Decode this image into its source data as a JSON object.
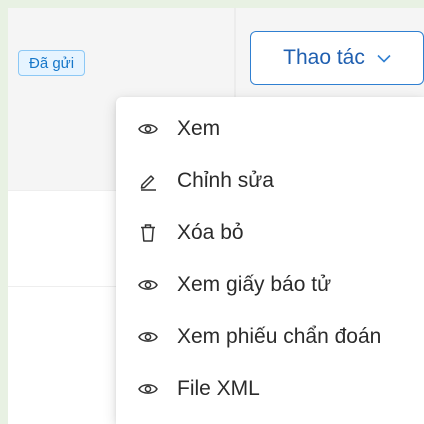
{
  "row": {
    "status_badge": "Đã gửi"
  },
  "actions": {
    "button_label": "Thao tác",
    "menu": [
      {
        "label": "Xem",
        "icon": "eye-icon"
      },
      {
        "label": "Chỉnh sửa",
        "icon": "pencil-icon"
      },
      {
        "label": "Xóa bỏ",
        "icon": "trash-icon"
      },
      {
        "label": "Xem giấy báo tử",
        "icon": "eye-icon"
      },
      {
        "label": "Xem phiếu chẩn đoán",
        "icon": "eye-icon"
      },
      {
        "label": "File XML",
        "icon": "eye-icon"
      }
    ]
  },
  "colors": {
    "accent": "#2f7fd1",
    "badge_bg": "#e6f4ff",
    "badge_text": "#1677c9"
  }
}
